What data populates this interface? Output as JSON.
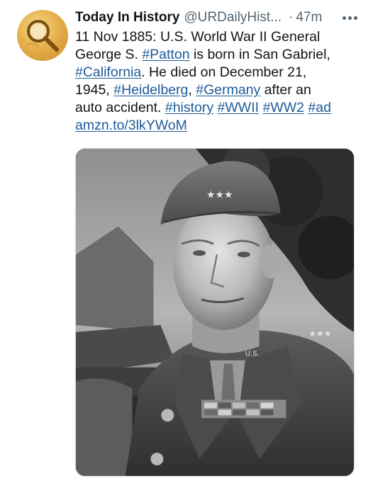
{
  "tweet": {
    "author": {
      "display_name": "Today In History",
      "handle": "@URDailyHist...",
      "avatar_icon": "magnifying-glass-icon"
    },
    "separator": "·",
    "time": "47m",
    "more_icon": "more-horizontal-icon",
    "text": {
      "line1_a": "11 Nov 1885: U.S. World War II General",
      "line2_a": "George S. ",
      "tag_patton": "#Patton",
      "line2_b": " is born in San Gabriel,",
      "tag_california": "#California",
      "line3_b": ". He died on December 21,",
      "line4_a": "1945, ",
      "tag_heidelberg": "#Heidelberg",
      "line4_b": ", ",
      "tag_germany": "#Germany",
      "line4_c": " after an",
      "line5_a": "auto accident. ",
      "tag_history": "#history",
      "tag_wwii": "#WWII",
      "tag_ww2": "#WW2",
      "tag_ad": "#ad",
      "link": "amzn.to/3lkYWoM"
    },
    "media": {
      "type": "photo",
      "badge": "U.S.",
      "description_icon": "photo-portrait"
    },
    "colors": {
      "link": "#1d5b9a",
      "secondary_text": "#536471",
      "avatar_bg": "#e6b04c"
    }
  }
}
